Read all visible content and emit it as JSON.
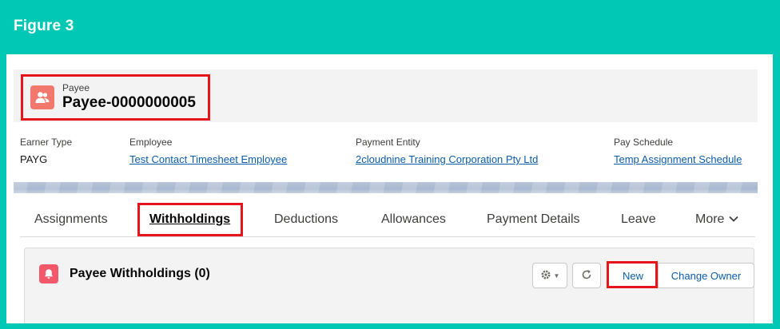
{
  "figure": {
    "title": "Figure 3"
  },
  "record": {
    "object_label": "Payee",
    "name": "Payee-0000000005",
    "icon": "payee-icon"
  },
  "fields": [
    {
      "label": "Earner Type",
      "value": "PAYG",
      "is_link": false
    },
    {
      "label": "Employee",
      "value": "Test Contact Timesheet Employee",
      "is_link": true
    },
    {
      "label": "Payment Entity",
      "value": "2cloudnine Training Corporation Pty Ltd",
      "is_link": true
    },
    {
      "label": "Pay Schedule",
      "value": "Temp Assignment Schedule",
      "is_link": true
    }
  ],
  "tabs": [
    {
      "label": "Assignments",
      "active": false
    },
    {
      "label": "Withholdings",
      "active": true
    },
    {
      "label": "Deductions",
      "active": false
    },
    {
      "label": "Allowances",
      "active": false
    },
    {
      "label": "Payment Details",
      "active": false
    },
    {
      "label": "Leave",
      "active": false
    },
    {
      "label": "More",
      "active": false
    }
  ],
  "related_list": {
    "title": "Payee Withholdings (0)",
    "icon": "bell-icon",
    "buttons": {
      "new": "New",
      "change_owner": "Change Owner"
    }
  },
  "colors": {
    "frame_teal": "#00c8b4",
    "highlight_red": "#e8141b",
    "link_blue": "#0b5cab",
    "payee_icon": "#f2786d",
    "withholding_icon": "#f2586a"
  }
}
